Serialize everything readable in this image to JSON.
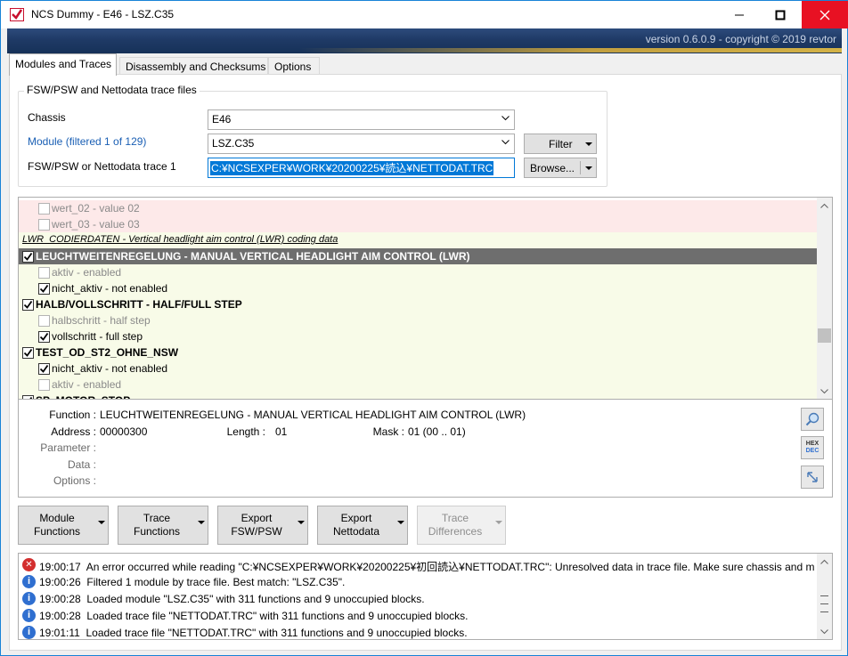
{
  "window": {
    "title": "NCS Dummy - E46 - LSZ.C35",
    "version": "version 0.6.0.9 - copyright © 2019 revtor"
  },
  "tabs": [
    {
      "label": "Modules and Traces"
    },
    {
      "label": "Disassembly and Checksums"
    },
    {
      "label": "Options"
    }
  ],
  "files_group": {
    "legend": "FSW/PSW and Nettodata trace files",
    "chassis_label": "Chassis",
    "chassis_value": "E46",
    "module_label": "Module (filtered 1 of 129)",
    "module_value": "LSZ.C35",
    "trace_label": "FSW/PSW or Nettodata trace 1",
    "trace_value": "C:¥NCSEXPER¥WORK¥20200225¥読込¥NETTODAT.TRC",
    "filter_button": "Filter",
    "browse_button": "Browse..."
  },
  "function_list": {
    "rows": [
      {
        "kind": "value",
        "checked": false,
        "text": "wert_02  -  value 02"
      },
      {
        "kind": "value",
        "checked": false,
        "text": "wert_03  -  value 03"
      },
      {
        "kind": "section",
        "text": "LWR_CODIERDATEN  -  Vertical headlight aim control (LWR) coding data"
      },
      {
        "kind": "function",
        "checked": true,
        "selected": true,
        "text": "LEUCHTWEITENREGELUNG  -  MANUAL VERTICAL HEADLIGHT AIM CONTROL (LWR)"
      },
      {
        "kind": "value",
        "checked": false,
        "text": "aktiv  -  enabled"
      },
      {
        "kind": "value",
        "checked": true,
        "text": "nicht_aktiv  -  not enabled"
      },
      {
        "kind": "function",
        "checked": true,
        "text": "HALB/VOLLSCHRITT  -  HALF/FULL STEP"
      },
      {
        "kind": "value",
        "checked": false,
        "text": "halbschritt  -  half step"
      },
      {
        "kind": "value",
        "checked": true,
        "text": "vollschritt  -  full step"
      },
      {
        "kind": "function",
        "checked": true,
        "text": "TEST_OD_ST2_OHNE_NSW"
      },
      {
        "kind": "value",
        "checked": true,
        "text": "nicht_aktiv  -  not enabled"
      },
      {
        "kind": "value",
        "checked": false,
        "text": "aktiv  -  enabled"
      },
      {
        "kind": "function",
        "checked": true,
        "text": "SP_MOTOR_STOP"
      }
    ]
  },
  "details": {
    "function_label": "Function :",
    "function_value": "LEUCHTWEITENREGELUNG  -  MANUAL VERTICAL HEADLIGHT AIM CONTROL (LWR)",
    "address_label": "Address :",
    "address_value": "00000300",
    "length_label": "Length :",
    "length_value": "01",
    "mask_label": "Mask :",
    "mask_value": "01  (00 .. 01)",
    "parameter_label": "Parameter :",
    "data_label": "Data :",
    "options_label": "Options :",
    "hex_label": "HEX",
    "dec_label": "DEC"
  },
  "actions": [
    {
      "line1": "Module",
      "line2": "Functions",
      "enabled": true
    },
    {
      "line1": "Trace",
      "line2": "Functions",
      "enabled": true
    },
    {
      "line1": "Export",
      "line2": "FSW/PSW",
      "enabled": true
    },
    {
      "line1": "Export",
      "line2": "Nettodata",
      "enabled": true
    },
    {
      "line1": "Trace",
      "line2": "Differences",
      "enabled": false
    }
  ],
  "log": [
    {
      "level": "error",
      "time": "19:00:17",
      "message": "An error occurred while reading \"C:¥NCSEXPER¥WORK¥20200225¥初回読込¥NETTODAT.TRC\": Unresolved data in trace file. Make sure chassis and module ..."
    },
    {
      "level": "info",
      "time": "19:00:26",
      "message": "Filtered 1 module by trace file. Best match: \"LSZ.C35\"."
    },
    {
      "level": "info",
      "time": "19:00:28",
      "message": "Loaded module \"LSZ.C35\" with 311 functions and 9 unoccupied blocks."
    },
    {
      "level": "info",
      "time": "19:00:28",
      "message": "Loaded trace file \"NETTODAT.TRC\" with 311 functions and 9 unoccupied blocks."
    },
    {
      "level": "info",
      "time": "19:01:11",
      "message": "Loaded trace file \"NETTODAT.TRC\" with 311 functions and 9 unoccupied blocks."
    }
  ],
  "colors": {
    "accent": "#0078d7",
    "close_button": "#e81123",
    "value_bg_top": "#fde9e9",
    "value_bg": "#f8fbe8",
    "selected_bg": "#6e6e6e",
    "error": "#d32f2f",
    "info": "#2f6fd0"
  }
}
